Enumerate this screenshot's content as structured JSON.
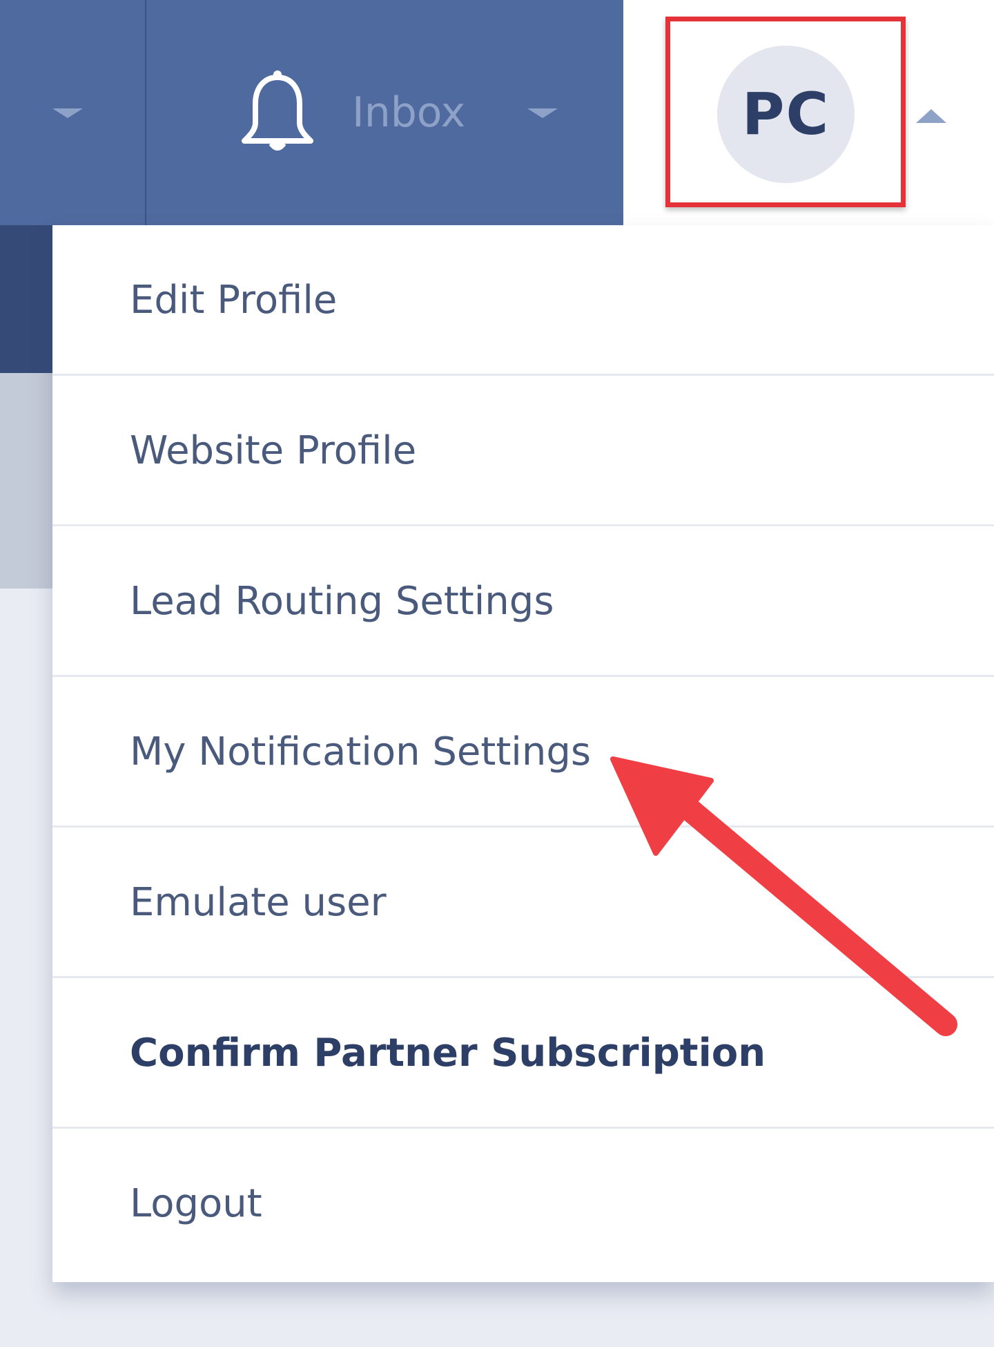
{
  "header": {
    "inbox_label": "Inbox",
    "avatar_initials": "PC"
  },
  "menu": {
    "items": [
      {
        "label": "Edit Profile"
      },
      {
        "label": "Website Profile"
      },
      {
        "label": "Lead Routing Settings"
      },
      {
        "label": "My Notification Settings"
      },
      {
        "label": "Emulate user"
      },
      {
        "label": "Confirm Partner Subscription"
      },
      {
        "label": "Logout"
      }
    ]
  },
  "colors": {
    "nav_blue": "#4f6a9f",
    "nav_dark": "#354a77",
    "menu_text": "#4a5a7c",
    "menu_text_bold": "#2d3f66",
    "highlight_red": "#e53238",
    "arrow_red": "#f03e45"
  },
  "icons": {
    "notifications": "bell-icon",
    "dropdown": "chevron-down-icon",
    "menu_open": "caret-up-icon"
  }
}
